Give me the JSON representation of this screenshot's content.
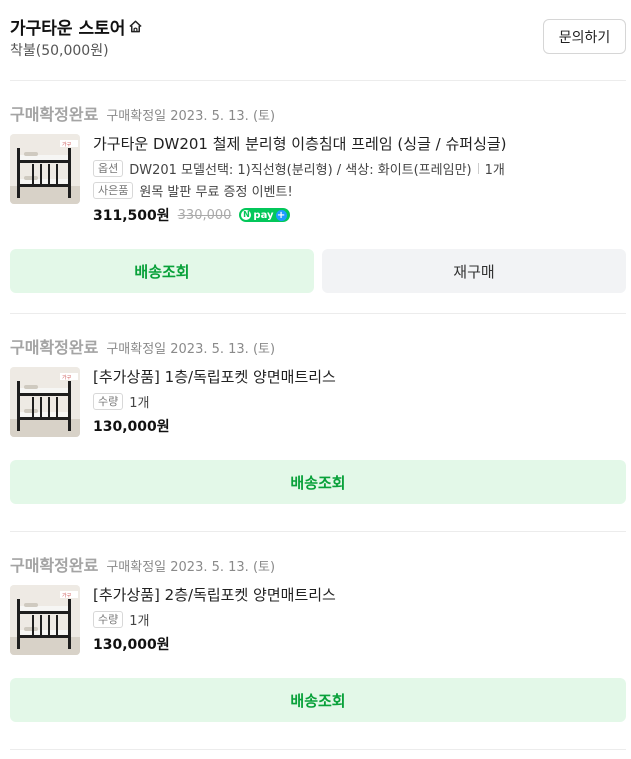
{
  "store": {
    "name": "가구타운 스토어",
    "payment": "착불(50,000원)",
    "inquiry_label": "문의하기"
  },
  "orders": [
    {
      "status": "구매확정완료",
      "confirm_date": "구매확정일 2023. 5. 13. (토)",
      "product_name": "가구타운 DW201 철제 분리형 이층침대 프레임 (싱글 / 슈퍼싱글)",
      "option_tag": "옵션",
      "option_text": "DW201 모델선택: 1)직선형(분리형) / 색상: 화이트(프레임만)",
      "quantity": "1개",
      "gift_tag": "사은품",
      "gift_text": "원목 발판 무료 증정 이벤트!",
      "price": "311,500원",
      "original_price": "330,000",
      "npay_label": "pay",
      "npay_n": "N",
      "npay_plus": "+",
      "track_label": "배송조회",
      "reorder_label": "재구매",
      "thumb_logo": "가구"
    },
    {
      "status": "구매확정완료",
      "confirm_date": "구매확정일 2023. 5. 13. (토)",
      "product_name": "[추가상품] 1층/독립포켓 양면매트리스",
      "qty_tag": "수량",
      "quantity": "1개",
      "price": "130,000원",
      "track_label": "배송조회",
      "thumb_logo": "가구"
    },
    {
      "status": "구매확정완료",
      "confirm_date": "구매확정일 2023. 5. 13. (토)",
      "product_name": "[추가상품] 2층/독립포켓 양면매트리스",
      "qty_tag": "수량",
      "quantity": "1개",
      "price": "130,000원",
      "track_label": "배송조회",
      "thumb_logo": "가구"
    }
  ]
}
